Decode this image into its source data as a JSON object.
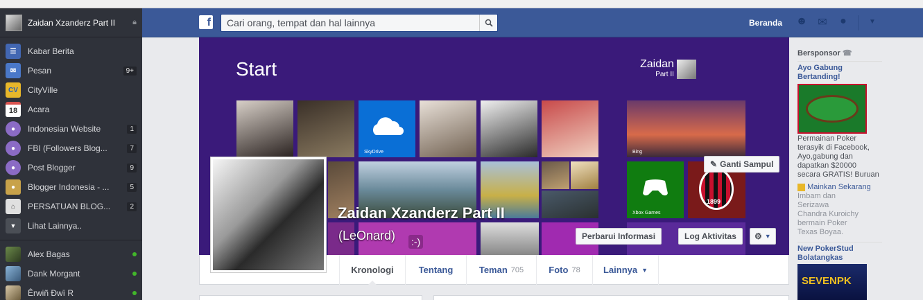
{
  "sidebar": {
    "profile_name": "Zaidan Xzanderz Part II",
    "items": [
      {
        "label": "Kabar Berita",
        "icon": "news-feed-icon",
        "count": ""
      },
      {
        "label": "Pesan",
        "icon": "messages-icon",
        "count": "9+"
      },
      {
        "label": "CityVille",
        "icon": "cityville-icon",
        "count": ""
      },
      {
        "label": "Acara",
        "icon": "events-icon",
        "icon_text": "18",
        "count": ""
      },
      {
        "label": "Indonesian Website",
        "icon": "group-icon",
        "count": "1"
      },
      {
        "label": "FBI (Followers Blog...",
        "icon": "group-icon",
        "count": "7"
      },
      {
        "label": "Post Blogger",
        "icon": "group-icon",
        "count": "9"
      },
      {
        "label": "Blogger Indonesia - ...",
        "icon": "group-icon",
        "count": "5"
      },
      {
        "label": "PERSATUAN BLOG...",
        "icon": "home-icon",
        "count": "2"
      },
      {
        "label": "Lihat Lainnya..",
        "icon": "chevron-down-icon",
        "count": ""
      }
    ],
    "friends": [
      {
        "name": "Alex Bagas"
      },
      {
        "name": "Dank Morgant"
      },
      {
        "name": "Êrwiñ Ðwï R"
      }
    ]
  },
  "topbar": {
    "search_placeholder": "Cari orang, tempat dan hal lainnya",
    "home_label": "Beranda",
    "logo_letter": "f"
  },
  "cover": {
    "start_title": "Start",
    "user_first": "Zaidan",
    "user_second": "Part II",
    "skydrive_label": "SkyDrive",
    "bing_label": "Bing",
    "xbox_label": "Xbox Games",
    "milan_year": "1899",
    "emoticon": ":-)",
    "change_cover": "Ganti Sampul",
    "update_info": "Perbarui Informasi",
    "activity_log": "Log Aktivitas"
  },
  "profile": {
    "name": "Zaidan Xzanderz Part II",
    "alt_name": "(LeOnard)"
  },
  "nav_tabs": [
    {
      "label": "Kronologi",
      "count": ""
    },
    {
      "label": "Tentang",
      "count": ""
    },
    {
      "label": "Teman",
      "count": "705"
    },
    {
      "label": "Foto",
      "count": "78"
    },
    {
      "label": "Lainnya",
      "count": ""
    }
  ],
  "sponsored": {
    "title": "Bersponsor",
    "ad1": {
      "title": "Ayo Gabung Bertanding!",
      "text": "Permainan Poker terasyik di Facebook, Ayo,gabung dan dapatkan $20000 secara GRATIS! Buruan",
      "link": "Mainkan Sekarang",
      "social": "Imbam dan Serizawa Chandra Kuroichy bermain Poker Texas Boyaa."
    },
    "ad2": {
      "title": "New PokerStud Bolatangkas",
      "img_text": "SEVENPK"
    }
  },
  "colors": {
    "facebook_blue": "#3b5998",
    "sidebar_bg": "#2f323a",
    "cover_purple": "#3a1a7a",
    "online_green": "#42b72a"
  }
}
